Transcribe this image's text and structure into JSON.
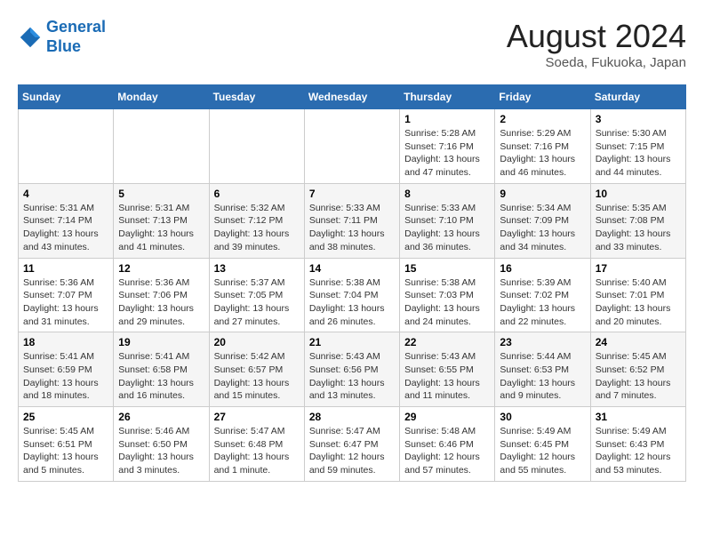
{
  "logo": {
    "line1": "General",
    "line2": "Blue"
  },
  "title": {
    "month_year": "August 2024",
    "location": "Soeda, Fukuoka, Japan"
  },
  "days_of_week": [
    "Sunday",
    "Monday",
    "Tuesday",
    "Wednesday",
    "Thursday",
    "Friday",
    "Saturday"
  ],
  "weeks": [
    [
      {
        "day": "",
        "info": ""
      },
      {
        "day": "",
        "info": ""
      },
      {
        "day": "",
        "info": ""
      },
      {
        "day": "",
        "info": ""
      },
      {
        "day": "1",
        "info": "Sunrise: 5:28 AM\nSunset: 7:16 PM\nDaylight: 13 hours\nand 47 minutes."
      },
      {
        "day": "2",
        "info": "Sunrise: 5:29 AM\nSunset: 7:16 PM\nDaylight: 13 hours\nand 46 minutes."
      },
      {
        "day": "3",
        "info": "Sunrise: 5:30 AM\nSunset: 7:15 PM\nDaylight: 13 hours\nand 44 minutes."
      }
    ],
    [
      {
        "day": "4",
        "info": "Sunrise: 5:31 AM\nSunset: 7:14 PM\nDaylight: 13 hours\nand 43 minutes."
      },
      {
        "day": "5",
        "info": "Sunrise: 5:31 AM\nSunset: 7:13 PM\nDaylight: 13 hours\nand 41 minutes."
      },
      {
        "day": "6",
        "info": "Sunrise: 5:32 AM\nSunset: 7:12 PM\nDaylight: 13 hours\nand 39 minutes."
      },
      {
        "day": "7",
        "info": "Sunrise: 5:33 AM\nSunset: 7:11 PM\nDaylight: 13 hours\nand 38 minutes."
      },
      {
        "day": "8",
        "info": "Sunrise: 5:33 AM\nSunset: 7:10 PM\nDaylight: 13 hours\nand 36 minutes."
      },
      {
        "day": "9",
        "info": "Sunrise: 5:34 AM\nSunset: 7:09 PM\nDaylight: 13 hours\nand 34 minutes."
      },
      {
        "day": "10",
        "info": "Sunrise: 5:35 AM\nSunset: 7:08 PM\nDaylight: 13 hours\nand 33 minutes."
      }
    ],
    [
      {
        "day": "11",
        "info": "Sunrise: 5:36 AM\nSunset: 7:07 PM\nDaylight: 13 hours\nand 31 minutes."
      },
      {
        "day": "12",
        "info": "Sunrise: 5:36 AM\nSunset: 7:06 PM\nDaylight: 13 hours\nand 29 minutes."
      },
      {
        "day": "13",
        "info": "Sunrise: 5:37 AM\nSunset: 7:05 PM\nDaylight: 13 hours\nand 27 minutes."
      },
      {
        "day": "14",
        "info": "Sunrise: 5:38 AM\nSunset: 7:04 PM\nDaylight: 13 hours\nand 26 minutes."
      },
      {
        "day": "15",
        "info": "Sunrise: 5:38 AM\nSunset: 7:03 PM\nDaylight: 13 hours\nand 24 minutes."
      },
      {
        "day": "16",
        "info": "Sunrise: 5:39 AM\nSunset: 7:02 PM\nDaylight: 13 hours\nand 22 minutes."
      },
      {
        "day": "17",
        "info": "Sunrise: 5:40 AM\nSunset: 7:01 PM\nDaylight: 13 hours\nand 20 minutes."
      }
    ],
    [
      {
        "day": "18",
        "info": "Sunrise: 5:41 AM\nSunset: 6:59 PM\nDaylight: 13 hours\nand 18 minutes."
      },
      {
        "day": "19",
        "info": "Sunrise: 5:41 AM\nSunset: 6:58 PM\nDaylight: 13 hours\nand 16 minutes."
      },
      {
        "day": "20",
        "info": "Sunrise: 5:42 AM\nSunset: 6:57 PM\nDaylight: 13 hours\nand 15 minutes."
      },
      {
        "day": "21",
        "info": "Sunrise: 5:43 AM\nSunset: 6:56 PM\nDaylight: 13 hours\nand 13 minutes."
      },
      {
        "day": "22",
        "info": "Sunrise: 5:43 AM\nSunset: 6:55 PM\nDaylight: 13 hours\nand 11 minutes."
      },
      {
        "day": "23",
        "info": "Sunrise: 5:44 AM\nSunset: 6:53 PM\nDaylight: 13 hours\nand 9 minutes."
      },
      {
        "day": "24",
        "info": "Sunrise: 5:45 AM\nSunset: 6:52 PM\nDaylight: 13 hours\nand 7 minutes."
      }
    ],
    [
      {
        "day": "25",
        "info": "Sunrise: 5:45 AM\nSunset: 6:51 PM\nDaylight: 13 hours\nand 5 minutes."
      },
      {
        "day": "26",
        "info": "Sunrise: 5:46 AM\nSunset: 6:50 PM\nDaylight: 13 hours\nand 3 minutes."
      },
      {
        "day": "27",
        "info": "Sunrise: 5:47 AM\nSunset: 6:48 PM\nDaylight: 13 hours\nand 1 minute."
      },
      {
        "day": "28",
        "info": "Sunrise: 5:47 AM\nSunset: 6:47 PM\nDaylight: 12 hours\nand 59 minutes."
      },
      {
        "day": "29",
        "info": "Sunrise: 5:48 AM\nSunset: 6:46 PM\nDaylight: 12 hours\nand 57 minutes."
      },
      {
        "day": "30",
        "info": "Sunrise: 5:49 AM\nSunset: 6:45 PM\nDaylight: 12 hours\nand 55 minutes."
      },
      {
        "day": "31",
        "info": "Sunrise: 5:49 AM\nSunset: 6:43 PM\nDaylight: 12 hours\nand 53 minutes."
      }
    ]
  ]
}
